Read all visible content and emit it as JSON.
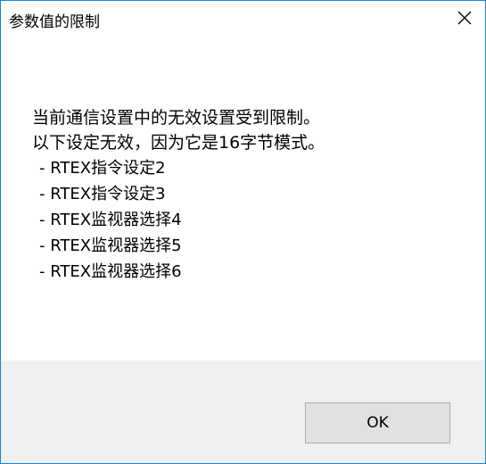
{
  "window": {
    "title": "参数值的限制",
    "close_icon": "close-icon"
  },
  "message": {
    "lines": [
      "当前通信设置中的无效设置受到限制。",
      "以下设定无效，因为它是16字节模式。"
    ],
    "items": [
      "- RTEX指令设定2",
      "- RTEX指令设定3",
      "- RTEX监视器选择4",
      "- RTEX监视器选择5",
      "- RTEX监视器选择6"
    ]
  },
  "buttons": {
    "ok_label": "OK"
  },
  "colors": {
    "window_border": "#1883d7",
    "footer_background": "#f0f0f0",
    "button_background": "#e1e1e1",
    "button_border": "#adadad"
  }
}
